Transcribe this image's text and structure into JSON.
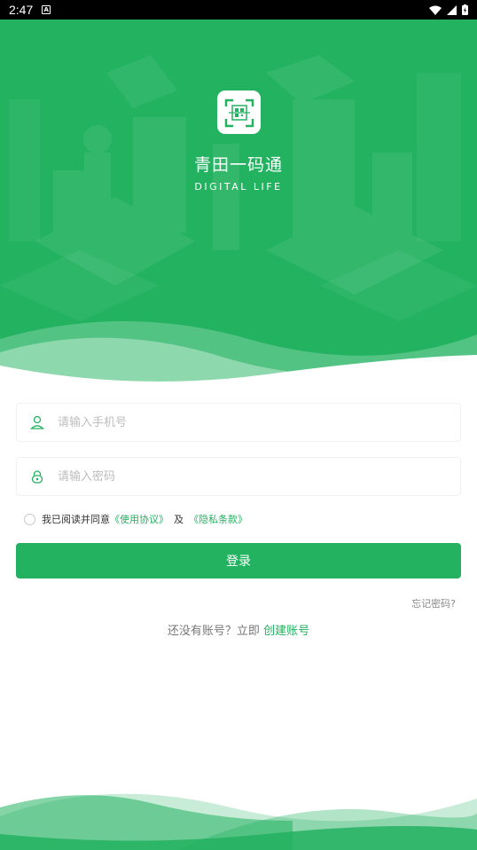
{
  "status_bar": {
    "time": "2:47",
    "notification_icon": "A"
  },
  "app": {
    "title": "青田一码通",
    "subtitle": "DIGITAL LIFE",
    "logo_icon": "qr-scan-icon"
  },
  "form": {
    "phone_placeholder": "请输入手机号",
    "password_placeholder": "请输入密码",
    "agreement_text": "我已阅读并同意",
    "user_agreement_link": "《使用协议》",
    "and_text": "及",
    "privacy_link": "《隐私条款》",
    "login_button": "登录",
    "forgot_password": "忘记密码?",
    "no_account_text": "还没有账号？立即",
    "create_account_link": "创建账号"
  },
  "colors": {
    "primary": "#22b260",
    "placeholder": "#bdbdbd"
  }
}
